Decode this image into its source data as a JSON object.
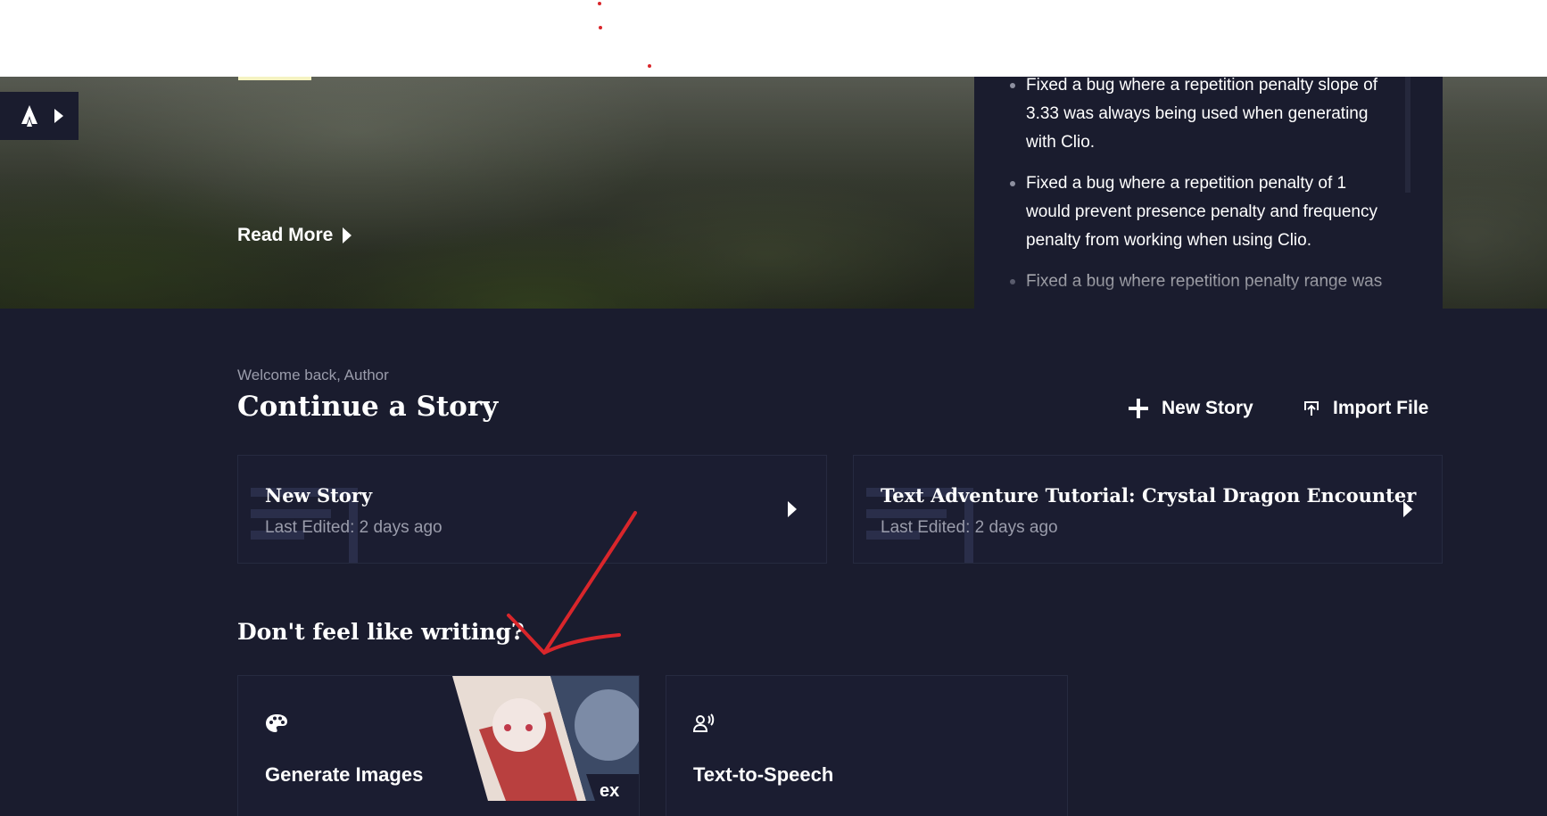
{
  "hero": {
    "read_more": "Read More",
    "changelog": [
      "Fixed a bug where a repetition penalty slope of 3.33 was always being used when generating with Clio.",
      "Fixed a bug where a repetition penalty of 1 would prevent presence penalty and frequency penalty from working when using Clio.",
      "Fixed a bug where repetition penalty range was"
    ]
  },
  "main": {
    "welcome": "Welcome back, Author",
    "title": "Continue a Story",
    "actions": {
      "new_story": "New Story",
      "import_file": "Import File"
    },
    "stories": [
      {
        "title": "New Story",
        "meta": "Last Edited: 2 days ago"
      },
      {
        "title": "Text Adventure Tutorial: Crystal Dragon Encounter",
        "meta": "Last Edited: 2 days ago"
      }
    ],
    "section_title": "Don't feel like writing?",
    "tools": [
      {
        "label": "Generate Images",
        "icon": "palette-icon"
      },
      {
        "label": "Text-to-Speech",
        "icon": "speaker-voice-icon"
      }
    ]
  },
  "colors": {
    "background": "#1a1c2e",
    "card": "#1b1d31",
    "muted_text": "#9a9cab",
    "annotation": "#d9262b",
    "highlight": "#f5f3c2"
  }
}
